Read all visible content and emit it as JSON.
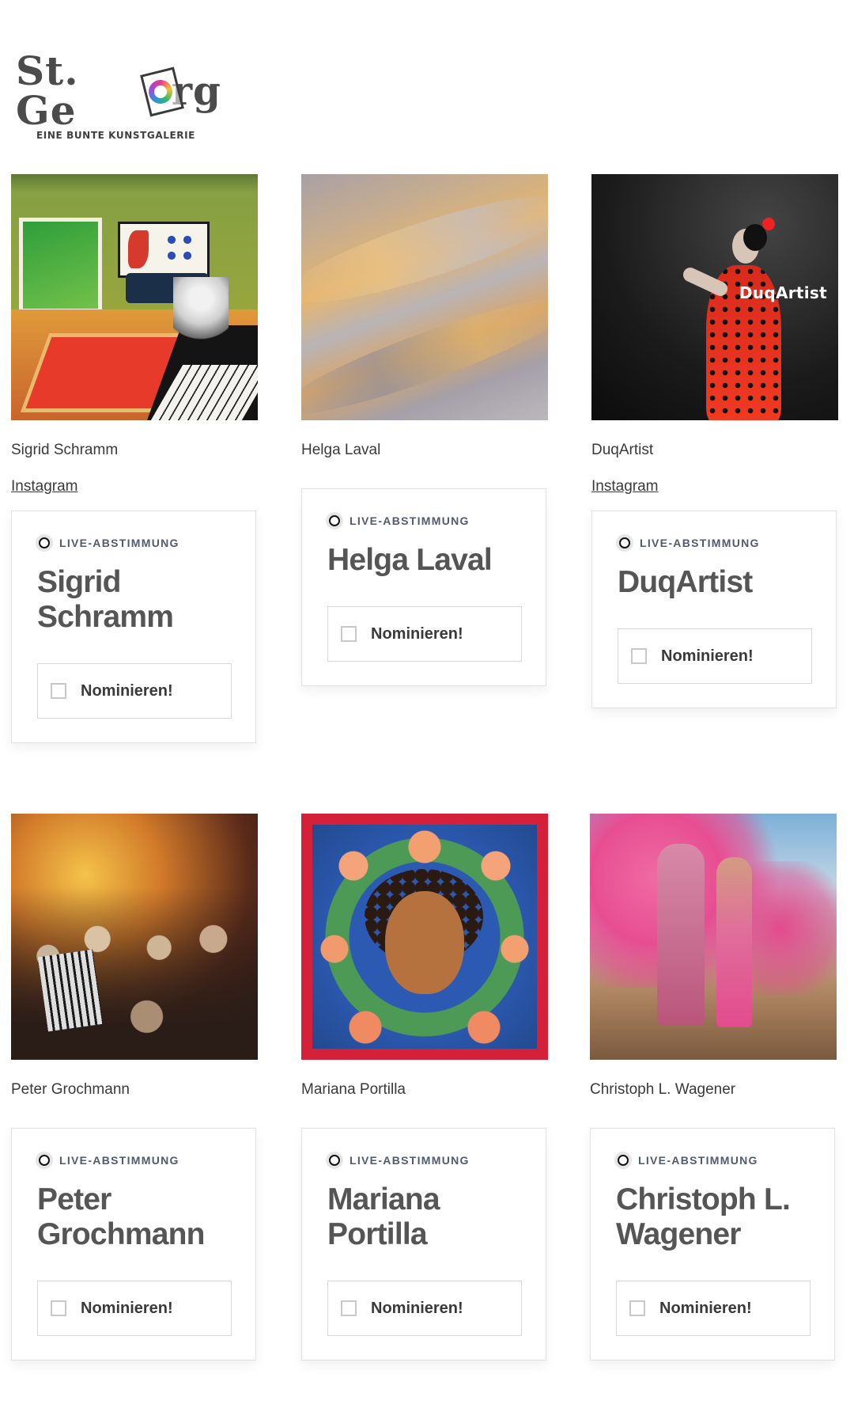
{
  "logo": {
    "wordmark_left": "St. Ge",
    "wordmark_right": "rg",
    "tagline": "EINE BUNTE KUNSTGALERIE"
  },
  "artists": [
    {
      "name": "Sigrid Schramm",
      "link": "Instagram",
      "live_label": "LIVE-ABSTIMMUNG",
      "card_title": "Sigrid Schramm",
      "nominate_label": "Nominieren!"
    },
    {
      "name": "Helga Laval",
      "live_label": "LIVE-ABSTIMMUNG",
      "card_title": "Helga Laval",
      "nominate_label": "Nominieren!"
    },
    {
      "name": "DuqArtist",
      "link": "Instagram",
      "artwork_caption": "DuqArtist",
      "live_label": "LIVE-ABSTIMMUNG",
      "card_title": "DuqArtist",
      "nominate_label": "Nominieren!"
    },
    {
      "name": "Peter Grochmann",
      "live_label": "LIVE-ABSTIMMUNG",
      "card_title": "Peter Grochmann",
      "nominate_label": "Nominieren!"
    },
    {
      "name": "Mariana Portilla",
      "live_label": "LIVE-ABSTIMMUNG",
      "card_title": "Mariana Portilla",
      "nominate_label": "Nominieren!"
    },
    {
      "name": "Christoph L. Wagener",
      "live_label": "LIVE-ABSTIMMUNG",
      "card_title": "Christoph L. Wagener",
      "nominate_label": "Nominieren!"
    }
  ]
}
